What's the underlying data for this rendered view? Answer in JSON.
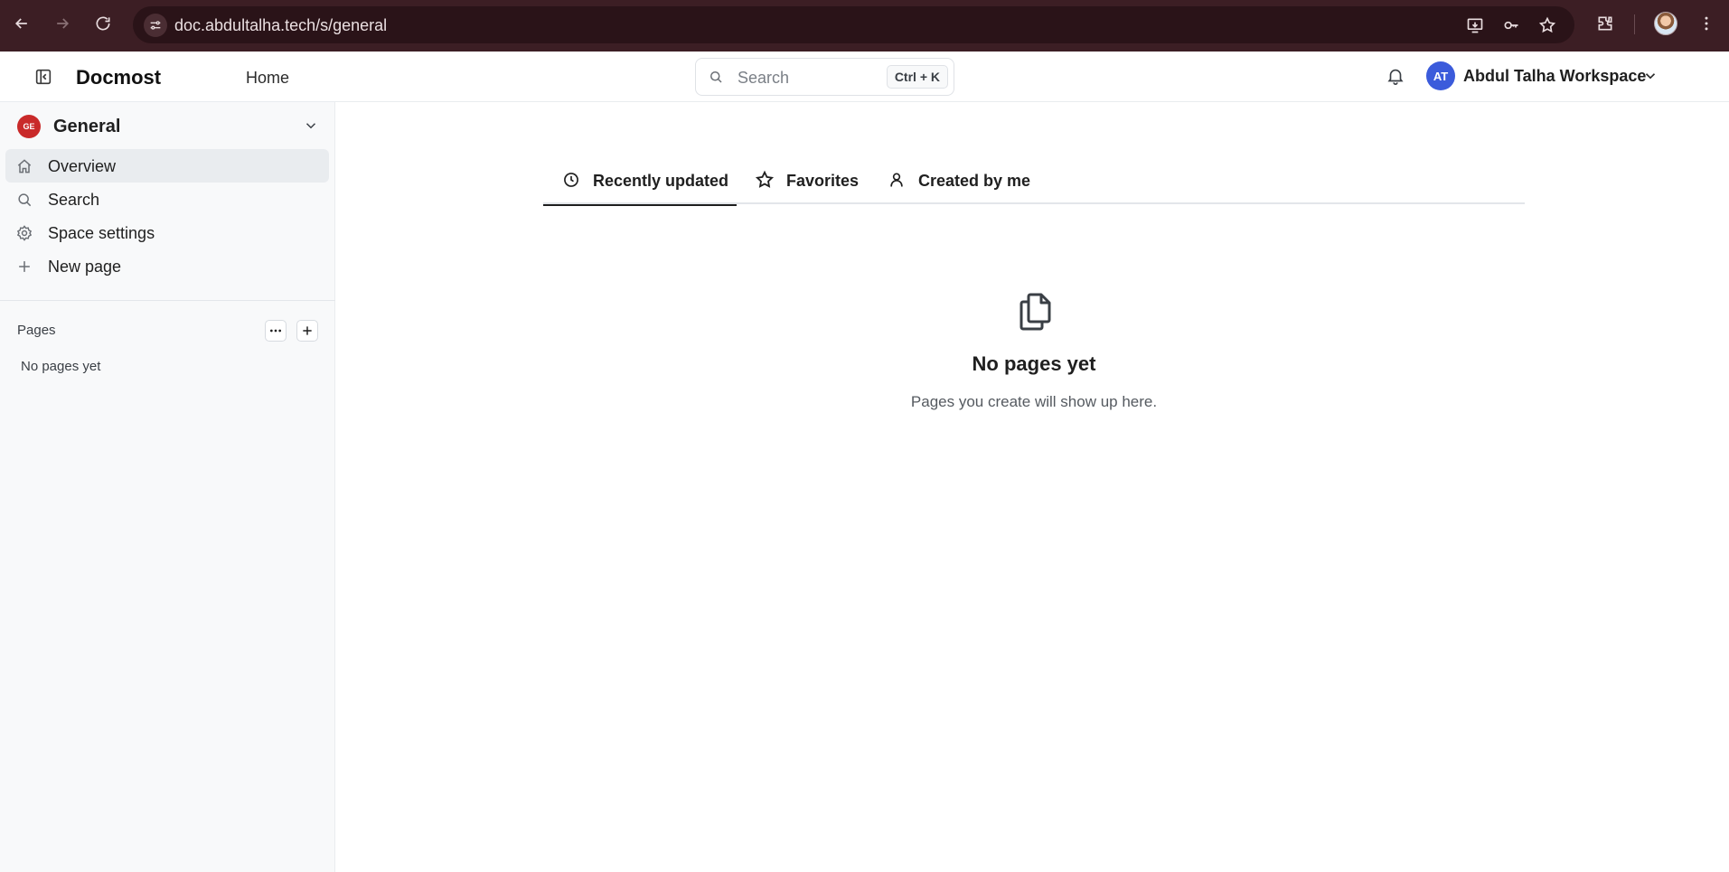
{
  "browser": {
    "url": "doc.abdultalha.tech/s/general"
  },
  "header": {
    "brand": "Docmost",
    "home_label": "Home",
    "search_placeholder": "Search",
    "search_shortcut": "Ctrl + K",
    "workspace_initials": "AT",
    "workspace_name": "Abdul Talha Workspace"
  },
  "sidebar": {
    "space_initials": "GE",
    "space_name": "General",
    "items": [
      {
        "label": "Overview",
        "icon": "home-icon",
        "active": true
      },
      {
        "label": "Search",
        "icon": "search-icon",
        "active": false
      },
      {
        "label": "Space settings",
        "icon": "gear-icon",
        "active": false
      },
      {
        "label": "New page",
        "icon": "plus-icon",
        "active": false
      }
    ],
    "pages_label": "Pages",
    "no_pages": "No pages yet"
  },
  "main": {
    "tabs": [
      {
        "label": "Recently updated",
        "icon": "clock-icon",
        "active": true
      },
      {
        "label": "Favorites",
        "icon": "star-icon",
        "active": false
      },
      {
        "label": "Created by me",
        "icon": "user-icon",
        "active": false
      }
    ],
    "empty_title": "No pages yet",
    "empty_subtitle": "Pages you create will show up here."
  },
  "colors": {
    "chrome_bg": "#3c1e24",
    "workspace_avatar": "#3b5bdb",
    "space_avatar": "#c92a2a"
  }
}
